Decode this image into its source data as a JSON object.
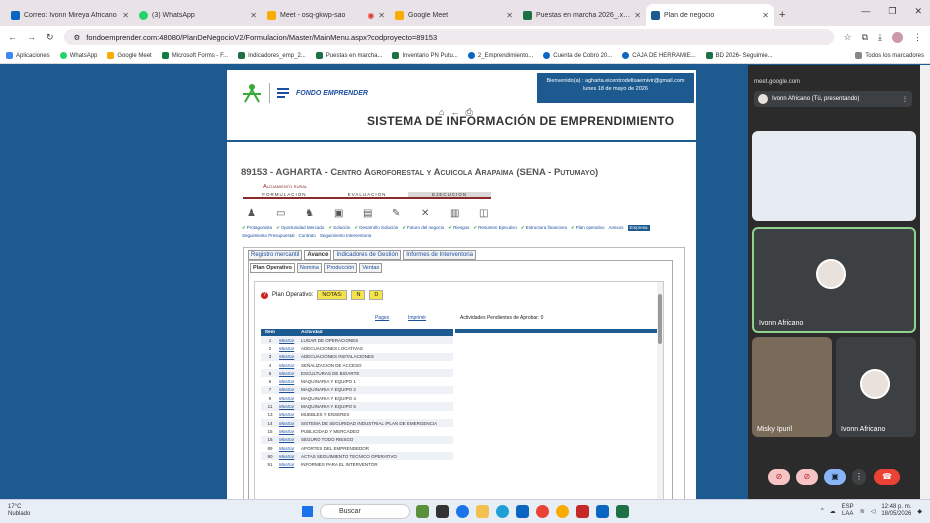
{
  "browser": {
    "tabs": [
      {
        "label": "Correo: Ivonn Mireya Africano",
        "color": "#0a66c2"
      },
      {
        "label": "(3) WhatsApp",
        "color": "#25d366"
      },
      {
        "label": "Meet - osq-gkwp-sao",
        "color": "#f9ab00"
      },
      {
        "label": "Google Meet",
        "color": "#f9ab00"
      },
      {
        "label": "Puestas en marcha 2026_.xlsx",
        "color": "#1e7145"
      },
      {
        "label": "Plan de negocio",
        "color": "#1c5a8f"
      }
    ],
    "url": "fondoemprender.com:48080/PlanDeNegocioV2/Formulacion/Master/MainMenu.aspx?codproyecto=89153",
    "bookmarks": [
      "Aplicaciones",
      "WhatsApp",
      "Google Meet",
      "Microsoft Forms - F...",
      "Indicadores_emp_2...",
      "Puestas en marcha...",
      "Inventario PN Putu...",
      "2_Emprendimiento...",
      "Cuenta de Cobro 20...",
      "CAJA DE HERRAMIE...",
      "BD 2026- Seguimie...",
      "Todos los marcadores"
    ]
  },
  "header": {
    "welcome": "Bienvenido(a) : agharta.eicentrodellsaemivir@gmail.com",
    "date": "lunes 18 de mayo de 2026",
    "logo_text": "FONDO EMPRENDER",
    "system_title": "SISTEMA DE INFORMACIÓN DE EMPRENDIMIENTO"
  },
  "project": {
    "title": "89153 - AGHARTA - Centro Agroforestal y Acuicola Arapaima (SENA - Putumayo)",
    "subtitle": "Alojamiento rural",
    "stages": [
      "FORMULACION",
      "EVALUACION",
      "EJECUCION"
    ],
    "links": [
      {
        "label": "Protagonista",
        "check": true
      },
      {
        "label": "Oportunidad Mercado",
        "check": true
      },
      {
        "label": "Solución",
        "check": true
      },
      {
        "label": "Desarrollo Solución",
        "check": true
      },
      {
        "label": "Futuro del negocio",
        "check": true
      },
      {
        "label": "Riesgos",
        "check": true
      },
      {
        "label": "Resumen Ejecutivo",
        "check": true
      },
      {
        "label": "Estructura financiera",
        "check": true
      },
      {
        "label": "Plan operativo",
        "check": true
      },
      {
        "label": "Anexos",
        "check": false
      },
      {
        "label": "Empresa",
        "check": false
      },
      {
        "label": "Seguimiento Presupuestal",
        "check": false
      },
      {
        "label": "Contrato",
        "check": false
      },
      {
        "label": "Seguimiento Interventoria",
        "check": false
      }
    ]
  },
  "tabs_main": [
    "Registro mercantil",
    "Avance",
    "Indicadores de Gestión",
    "Informes de Interventoria"
  ],
  "tabs_sub": [
    "Plan Operativo",
    "Nomina",
    "Producción",
    "Ventas"
  ],
  "plan": {
    "label": "Plan Operativo:",
    "notas": "NOTAS:",
    "btn1": "N",
    "btn2": "D",
    "pages": "Pages",
    "print": "Imprimir",
    "pending": "Actividades Pendientes de Aprobar: 0",
    "col_item": "Item",
    "col_activity": "Actividad",
    "show_label": "Mostrar",
    "rows": [
      {
        "item": "1",
        "act": "LUGAR DE OPERACIONES"
      },
      {
        "item": "2",
        "act": "ADECUACIONES LOCATIVAS"
      },
      {
        "item": "3",
        "act": "ADECUACIONES INSTALACIONES"
      },
      {
        "item": "4",
        "act": "SEÑALIZACION DE ACCESO"
      },
      {
        "item": "5",
        "act": "ESCULTURAS DE BIOARTE"
      },
      {
        "item": "6",
        "act": "MAQUINARIA Y EQUIPO 1"
      },
      {
        "item": "7",
        "act": "MAQUINARIA Y EQUIPO 2"
      },
      {
        "item": "9",
        "act": "MAQUINARIA Y EQUIPO 4"
      },
      {
        "item": "11",
        "act": "MAQUINARIA Y EQUIPO 6"
      },
      {
        "item": "13",
        "act": "MUEBLES Y ENSERES"
      },
      {
        "item": "14",
        "act": "SISTEMA DE SEGURIDAD INDUSTRIAL /PLAN DE EMERGENCIA"
      },
      {
        "item": "15",
        "act": "PUBLICIDAD Y MERCADEO"
      },
      {
        "item": "16",
        "act": "SEGURO TODO RIESGO"
      },
      {
        "item": "89",
        "act": "APORTES DEL EMPRENDEDOR"
      },
      {
        "item": "90",
        "act": "ACTAS SEGUIMIENTO TECNICO OPERATIVO"
      },
      {
        "item": "91",
        "act": "INFORMES PARA EL INTERVENTOR"
      }
    ]
  },
  "meet": {
    "site": "meet.google.com",
    "presenting": "Ivonn Africano (Tú, presentando)",
    "p1": "Ivonn Africano",
    "p2": "Misky Ipuril",
    "p3": "Ivonn Africano"
  },
  "taskbar": {
    "temp": "17°C",
    "weather": "Nublado",
    "search": "Buscar",
    "lang": "ESP",
    "lang2": "LAA",
    "time": "12:48 p. m.",
    "date": "18/05/2026"
  }
}
